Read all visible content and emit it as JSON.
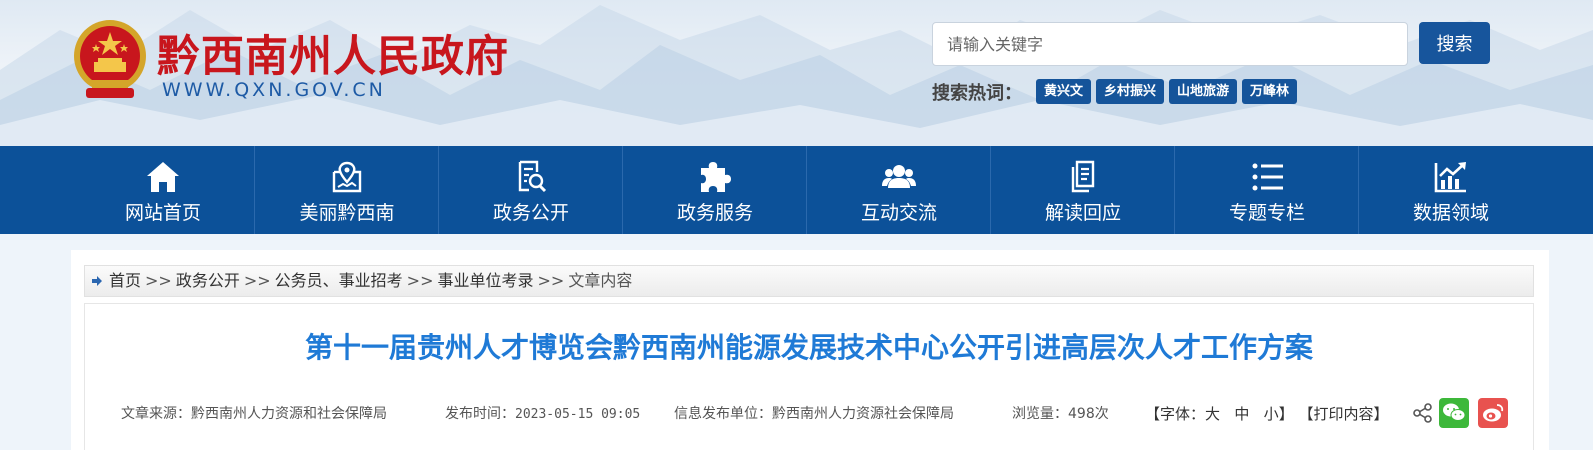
{
  "header": {
    "site_title": "黔西南州人民政府",
    "site_url": "WWW.QXN.GOV.CN",
    "search": {
      "placeholder": "请输入关键字",
      "button_label": "搜索"
    },
    "hot_label": "搜索热词：",
    "hot_tags": [
      "黄兴文",
      "乡村振兴",
      "山地旅游",
      "万峰林"
    ]
  },
  "nav": {
    "items": [
      {
        "label": "网站首页",
        "icon": "home-icon"
      },
      {
        "label": "美丽黔西南",
        "icon": "map-pin-icon"
      },
      {
        "label": "政务公开",
        "icon": "document-search-icon"
      },
      {
        "label": "政务服务",
        "icon": "puzzle-icon"
      },
      {
        "label": "互动交流",
        "icon": "users-icon"
      },
      {
        "label": "解读回应",
        "icon": "clipboard-icon"
      },
      {
        "label": "专题专栏",
        "icon": "list-icon"
      },
      {
        "label": "数据领域",
        "icon": "chart-icon"
      }
    ]
  },
  "breadcrumb": {
    "items": [
      "首页",
      "政务公开",
      "公务员、事业招考",
      "事业单位考录"
    ],
    "separator": ">>",
    "current": "文章内容"
  },
  "article": {
    "title": "第十一届贵州人才博览会黔西南州能源发展技术中心公开引进高层次人才工作方案",
    "meta": {
      "source_label": "文章来源：",
      "source": "黔西南州人力资源和社会保障局",
      "time_label": "发布时间：",
      "time": "2023-05-15 09:05",
      "publisher_label": "信息发布单位：",
      "publisher": "黔西南州人力资源社会保障局",
      "views_label": "浏览量：",
      "views": "498次"
    },
    "tools": {
      "font_prefix": "【字体：",
      "font_large": "大",
      "font_medium": "中",
      "font_small": "小",
      "font_suffix": "】",
      "print": "【打印内容】"
    }
  },
  "colors": {
    "nav_bg": "#0c5199",
    "title_red": "#c8161d",
    "article_title": "#1f7ad6",
    "tag_bg": "#15549a"
  }
}
